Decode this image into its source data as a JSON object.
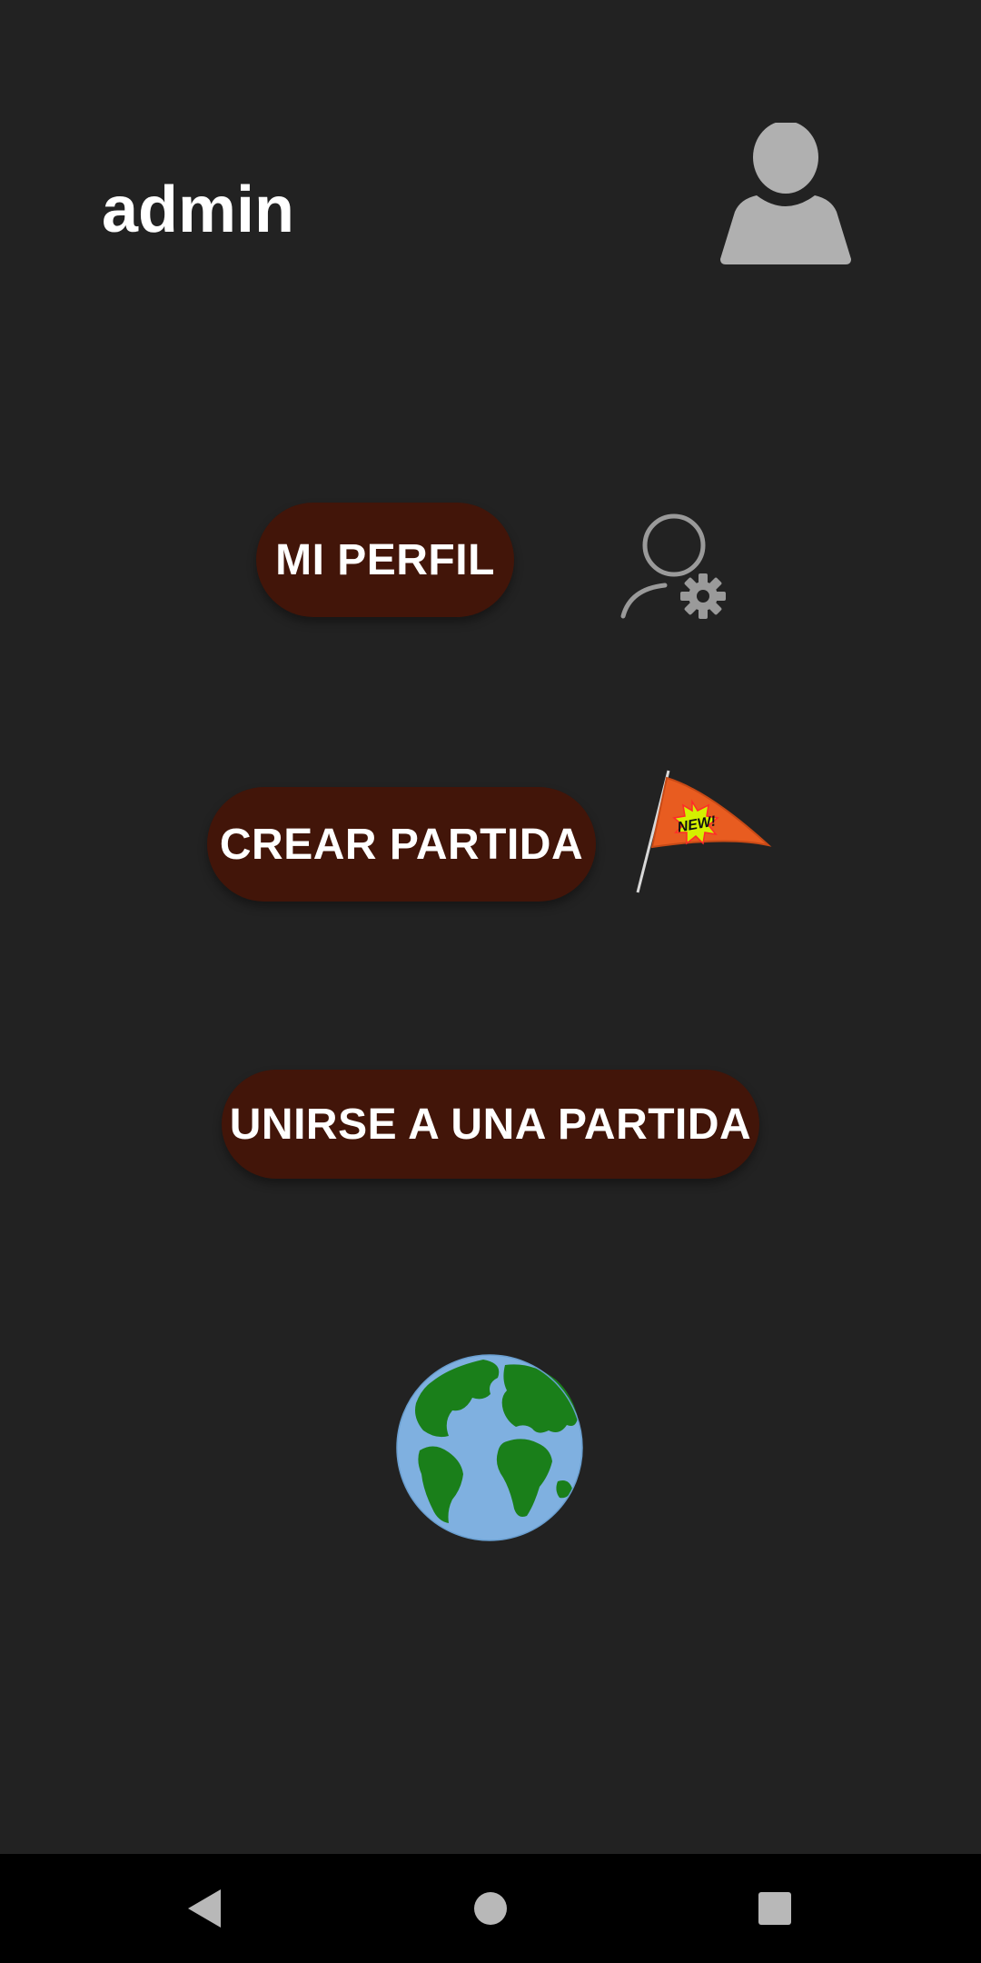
{
  "header": {
    "username": "admin",
    "avatar_icon": "user-silhouette-icon"
  },
  "menu": {
    "profile_label": "MI PERFIL",
    "profile_icon": "user-settings-icon",
    "create_label": "CREAR PARTIDA",
    "create_icon": "new-flag-icon",
    "create_badge": "NEW!",
    "join_label": "UNIRSE A UNA PARTIDA",
    "globe_icon": "globe-icon"
  },
  "navbar": {
    "back_icon": "back-triangle-icon",
    "home_icon": "home-circle-icon",
    "recents_icon": "recents-square-icon"
  },
  "colors": {
    "background": "#222222",
    "button": "#421509",
    "button_text": "#ffffff",
    "navbar": "#000000",
    "icon_gray": "#b0b0b0",
    "flag": "#e85c20",
    "badge": "#d4f000",
    "ocean": "#7fb0e0",
    "land": "#1a7f1a"
  }
}
